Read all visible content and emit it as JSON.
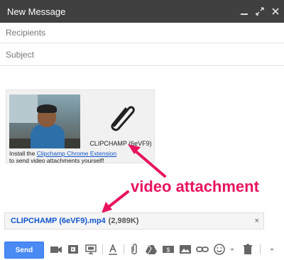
{
  "window": {
    "title": "New Message",
    "controls": [
      "minimize-icon",
      "expand-icon",
      "close-icon"
    ]
  },
  "fields": {
    "recipients_placeholder": "Recipients",
    "subject_placeholder": "Subject"
  },
  "card": {
    "clip_label": "CLIPCHAMP (6eVF9)",
    "install_prefix": "Install the ",
    "install_link": "Clipchamp Chrome Extension",
    "install_suffix": "to send video attachments yourself!"
  },
  "annotation": {
    "label": "video attachment",
    "color": "#e8135f"
  },
  "attachment": {
    "name": "CLIPCHAMP (6eVF9).mp4",
    "size": "(2,989K)",
    "close": "×"
  },
  "toolbar": {
    "send_label": "Send",
    "send_color": "#4a8af4",
    "icons": [
      "video-camera-icon",
      "film-icon",
      "screen-share-icon",
      "formatting-icon",
      "attach-icon",
      "drive-icon",
      "money-icon",
      "photo-icon",
      "link-icon",
      "emoji-icon",
      "trash-icon",
      "more-options-icon"
    ]
  }
}
